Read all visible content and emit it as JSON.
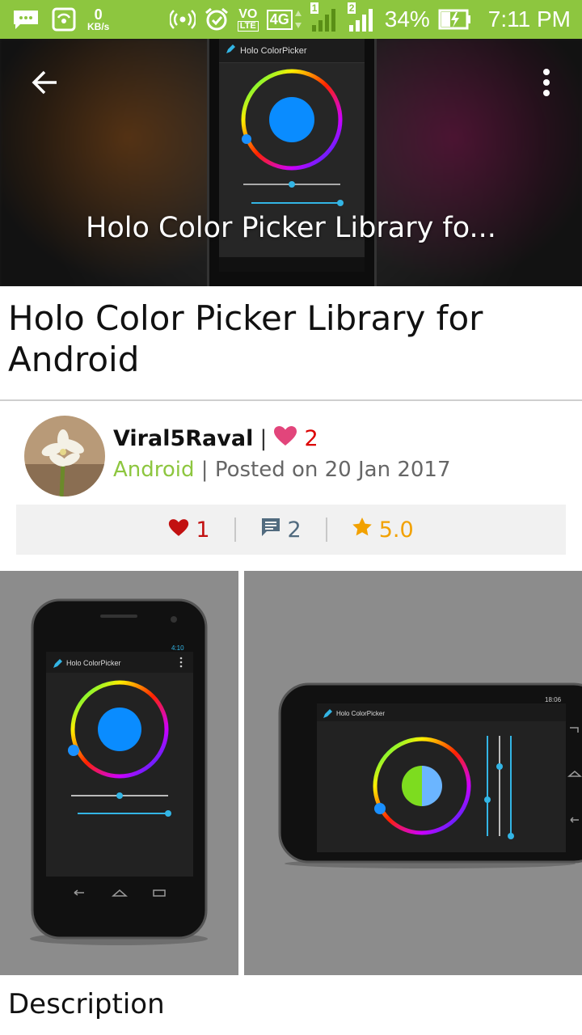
{
  "status_bar": {
    "net_speed_value": "0",
    "net_speed_unit": "KB/s",
    "volte_label": "VO",
    "lte_label": "LTE",
    "network_type": "4G",
    "sim1": "1",
    "sim2": "2",
    "battery_percent": "34%",
    "time": "7:11 PM",
    "bar_color": "#8dc63f"
  },
  "hero": {
    "overlay_title": "Holo Color Picker Library fo...",
    "screen_app_name": "Holo ColorPicker"
  },
  "post": {
    "title": "Holo Color Picker Library for Android",
    "author_name": "Viral5Raval",
    "author_separator": "|",
    "author_heart_count": "2",
    "category": "Android",
    "posted_separator": "|",
    "posted_text": "Posted on 20 Jan 2017"
  },
  "stats": {
    "likes": "1",
    "comments": "2",
    "rating": "5.0",
    "like_color": "#c21111",
    "comment_color": "#516b7f",
    "rating_color": "#f2a100"
  },
  "gallery": {
    "shot1_app_name": "Holo ColorPicker",
    "shot1_status_time": "4:10",
    "shot2_app_name": "Holo ColorPicker",
    "shot2_status_time": "18:06"
  },
  "sections": {
    "description_heading": "Description"
  },
  "icons": {
    "back": "arrow-left-icon",
    "menu": "more-vertical-icon",
    "heart": "heart-icon",
    "comment": "comment-icon",
    "star": "star-icon"
  }
}
